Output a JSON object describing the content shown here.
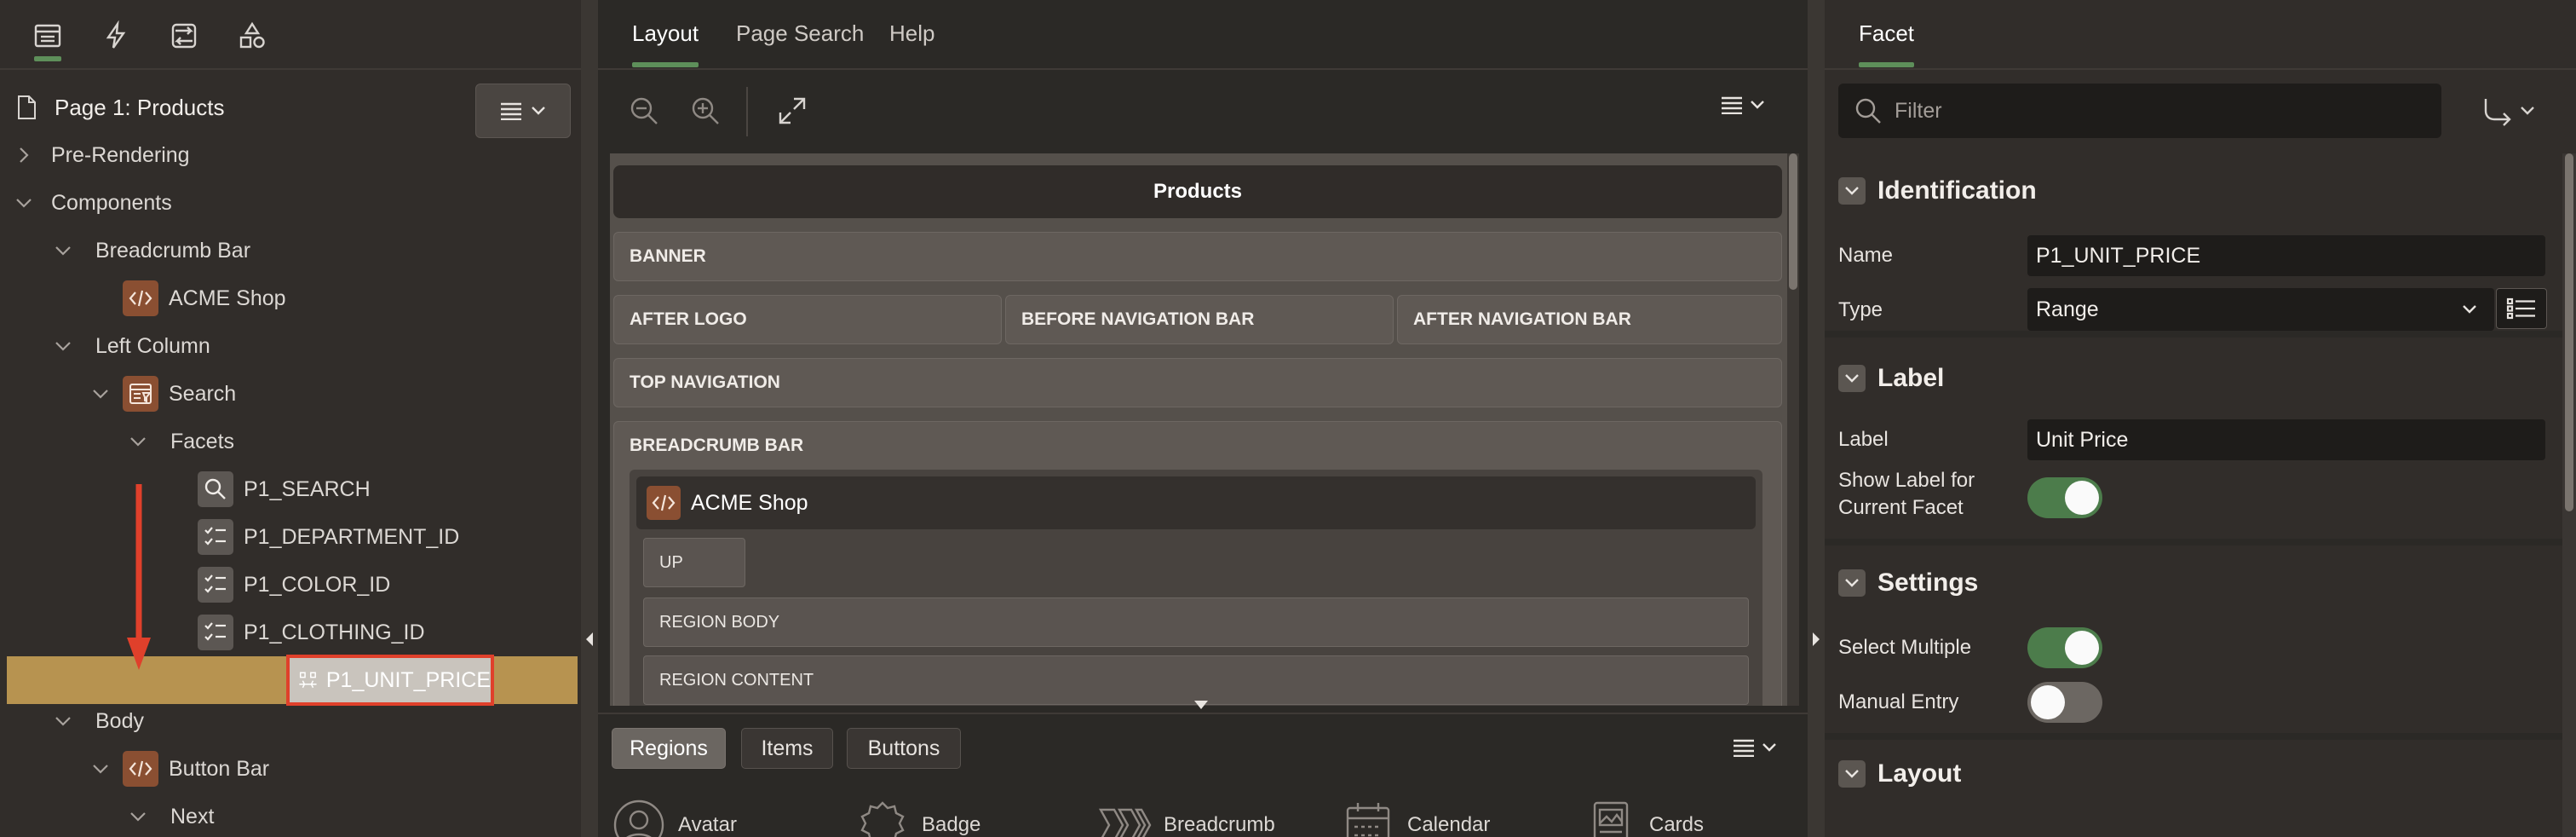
{
  "left_panel": {
    "toolbar": [
      {
        "name": "rendering-tab",
        "icon": "rendering-icon",
        "active": true
      },
      {
        "name": "dynamic-actions-tab",
        "icon": "lightning-icon",
        "active": false
      },
      {
        "name": "processing-tab",
        "icon": "processing-icon",
        "active": false
      },
      {
        "name": "shared-components-tab",
        "icon": "shapes-icon",
        "active": false
      }
    ],
    "page_title": "Page 1: Products",
    "tree": {
      "pre_rendering": "Pre-Rendering",
      "components": "Components",
      "breadcrumb_bar": "Breadcrumb Bar",
      "acme_shop": "ACME Shop",
      "left_column": "Left Column",
      "search": "Search",
      "facets": "Facets",
      "facet_items": [
        "P1_SEARCH",
        "P1_DEPARTMENT_ID",
        "P1_COLOR_ID",
        "P1_CLOTHING_ID"
      ],
      "dragged_item": "P1_UNIT_PRICE",
      "body": "Body",
      "button_bar": "Button Bar",
      "next": "Next"
    }
  },
  "center_panel": {
    "tabs": [
      "Layout",
      "Page Search",
      "Help"
    ],
    "active_tab": "Layout",
    "canvas": {
      "page_title": "Products",
      "banner": "BANNER",
      "after_logo": "AFTER LOGO",
      "before_navigation_bar": "BEFORE NAVIGATION BAR",
      "after_navigation_bar": "AFTER NAVIGATION BAR",
      "top_navigation": "TOP NAVIGATION",
      "breadcrumb_bar": "BREADCRUMB BAR",
      "acme_shop": "ACME Shop",
      "up": "UP",
      "region_body": "REGION BODY",
      "region_content": "REGION CONTENT"
    },
    "gallery": {
      "tabs": [
        "Regions",
        "Items",
        "Buttons"
      ],
      "active_tab": "Regions",
      "items": [
        "Avatar",
        "Badge",
        "Breadcrumb",
        "Calendar",
        "Cards"
      ]
    }
  },
  "right_panel": {
    "tab": "Facet",
    "filter_placeholder": "Filter",
    "groups": {
      "identification": "Identification",
      "label": "Label",
      "settings": "Settings",
      "layout": "Layout"
    },
    "props": {
      "name_label": "Name",
      "name_value": "P1_UNIT_PRICE",
      "type_label": "Type",
      "type_value": "Range",
      "label_label": "Label",
      "label_value": "Unit Price",
      "show_label_text": "Show Label for Current Facet",
      "show_label_on": true,
      "select_multiple_label": "Select Multiple",
      "select_multiple_on": true,
      "manual_entry_label": "Manual Entry",
      "manual_entry_on": false
    }
  },
  "colors": {
    "accent_green": "#5e8f5a",
    "drop_zone": "#b79350",
    "drag_highlight": "#e0402b",
    "component_icon": "#8a4f32"
  }
}
